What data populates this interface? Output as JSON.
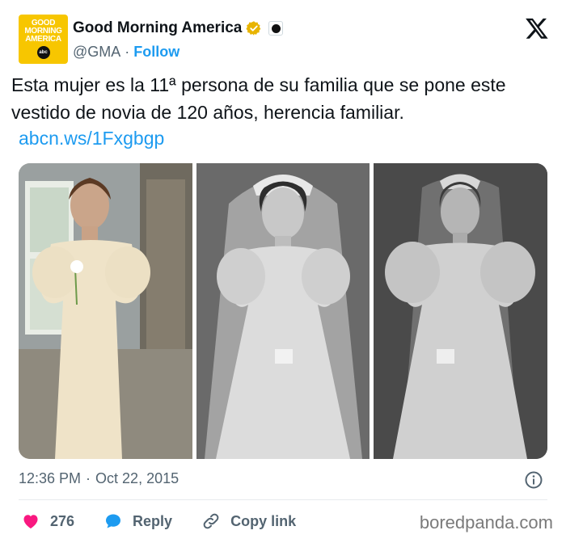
{
  "author": {
    "avatar_text": [
      "GOOD",
      "MORNING",
      "AMERICA"
    ],
    "avatar_badge": "abc",
    "display_name": "Good Morning America",
    "handle": "@GMA",
    "separator": "·",
    "follow_label": "Follow",
    "verified_color": "#e8b400"
  },
  "tweet": {
    "text": "Esta mujer es la 11ª persona de su familia que se pone este vestido de novia de 120 años, herencia familiar.",
    "link": "abcn.ws/1Fxgbgp"
  },
  "media": {
    "photos": [
      {
        "icon": "photo-color-bride"
      },
      {
        "icon": "photo-bw-bride-1"
      },
      {
        "icon": "photo-bw-bride-2"
      }
    ]
  },
  "meta": {
    "time": "12:36 PM",
    "separator": "·",
    "date": "Oct 22, 2015"
  },
  "actions": {
    "like_count": "276",
    "reply_label": "Reply",
    "copy_label": "Copy link",
    "like_color": "#f91880",
    "reply_color": "#1d9bf0"
  },
  "watermark": "boredpanda.com"
}
